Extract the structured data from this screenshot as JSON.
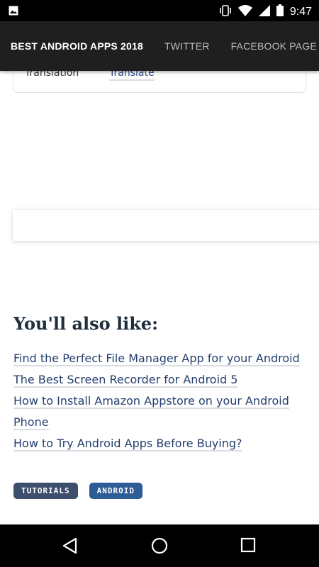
{
  "status_bar": {
    "time": "9:47"
  },
  "top_nav": {
    "links": [
      "BEST ANDROID APPS 2018",
      "TWITTER",
      "FACEBOOK PAGE"
    ]
  },
  "info_card": {
    "label": "Translation",
    "link": "Translate"
  },
  "related": {
    "heading": "You'll also like:",
    "links": [
      "Find the Perfect File Manager App for your Android",
      "The Best Screen Recorder for Android 5",
      "How to Install Amazon Appstore on your Android Phone",
      "How to Try Android Apps Before Buying?"
    ]
  },
  "tags": [
    "TUTORIALS",
    "ANDROID"
  ],
  "colors": {
    "nav_background": "#1f1f1f",
    "link": "#243f6e",
    "tag_tutorials": "#3e4f6e",
    "tag_android": "#2e5c97"
  }
}
